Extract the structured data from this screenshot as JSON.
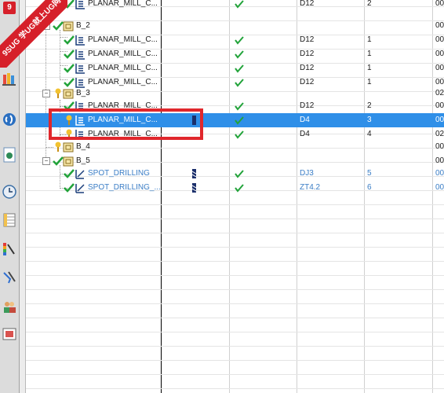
{
  "watermark": {
    "logo_text": "9",
    "line1": "9SUG",
    "line2": "学UG就上UG网"
  },
  "rail_icons": [
    "library-icon",
    "signal-icon",
    "document-icon",
    "clock-icon",
    "spreadsheet-icon",
    "color-palette-icon",
    "tools-icon",
    "users-icon",
    "picture-icon"
  ],
  "rows": [
    {
      "id": "r0",
      "name": "PLANAR_MILL_C...",
      "cols": {
        "status": "✔",
        "tool": "D12",
        "num": "2",
        "extra": "00"
      }
    },
    {
      "id": "r1",
      "name": "B_2",
      "cols": {
        "status": "",
        "tool": "",
        "num": "",
        "extra": "00"
      }
    },
    {
      "id": "r2",
      "name": "PLANAR_MILL_C...",
      "cols": {
        "status": "✔",
        "tool": "D12",
        "num": "1",
        "extra": "00"
      }
    },
    {
      "id": "r3",
      "name": "PLANAR_MILL_C...",
      "cols": {
        "status": "✔",
        "tool": "D12",
        "num": "1",
        "extra": "00"
      }
    },
    {
      "id": "r4",
      "name": "PLANAR_MILL_C...",
      "cols": {
        "status": "✔",
        "tool": "D12",
        "num": "1",
        "extra": "00"
      }
    },
    {
      "id": "r5",
      "name": "PLANAR_MILL_C...",
      "cols": {
        "status": "✔",
        "tool": "D12",
        "num": "1",
        "extra": "00"
      }
    },
    {
      "id": "r6",
      "name": "B_3",
      "cols": {
        "status": "",
        "tool": "",
        "num": "",
        "extra": "02"
      }
    },
    {
      "id": "r7",
      "name": "PLANAR_MILL_C...",
      "cols": {
        "status": "✔",
        "tool": "D12",
        "num": "2",
        "extra": "00"
      }
    },
    {
      "id": "r8",
      "name": "PLANAR_MILL_C...",
      "cols": {
        "status": "✔",
        "tool": "D4",
        "num": "3",
        "extra": "00"
      }
    },
    {
      "id": "r9",
      "name": "PLANAR_MILL_C...",
      "cols": {
        "status": "✔",
        "tool": "D4",
        "num": "4",
        "extra": "02"
      }
    },
    {
      "id": "r10",
      "name": "B_4",
      "cols": {
        "status": "",
        "tool": "",
        "num": "",
        "extra": "00"
      }
    },
    {
      "id": "r11",
      "name": "B_5",
      "cols": {
        "status": "",
        "tool": "",
        "num": "",
        "extra": "00"
      }
    },
    {
      "id": "r12",
      "name": "SPOT_DRILLING",
      "cols": {
        "status": "✔",
        "tool": "DJ3",
        "num": "5",
        "extra": "00"
      }
    },
    {
      "id": "r13",
      "name": "SPOT_DRILLING_...",
      "cols": {
        "status": "✔",
        "tool": "ZT4.2",
        "num": "6",
        "extra": "00"
      }
    }
  ],
  "colors": {
    "selection": "#2f8fe8",
    "link_text": "#3b7ec6",
    "check_green": "#22a33a",
    "highlight_box": "#e0272c"
  }
}
